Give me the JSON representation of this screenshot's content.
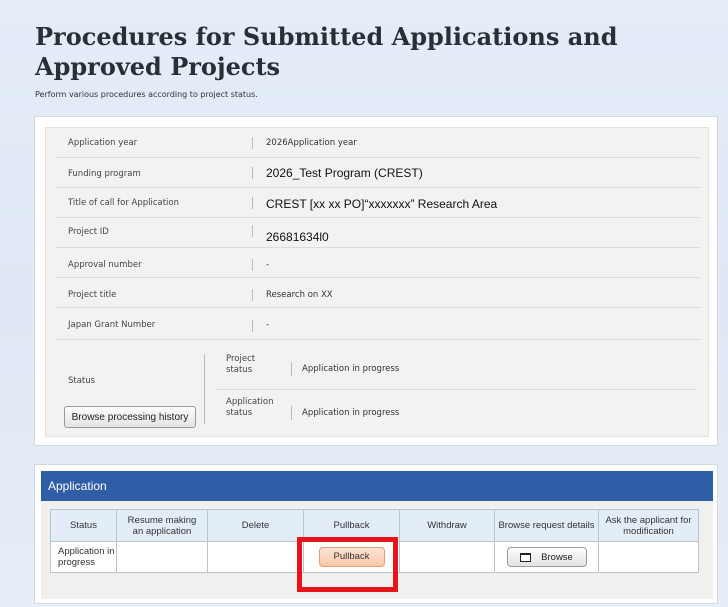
{
  "page": {
    "title": "Procedures for Submitted Applications and Approved Projects",
    "subtitle": "Perform various procedures according to project status."
  },
  "info": {
    "rows": [
      {
        "label": "Application year",
        "value": "2026Application year"
      },
      {
        "label": "Funding program",
        "value": "2026_Test Program (CREST)"
      },
      {
        "label": "Title of call for Application",
        "value": "CREST [xx xx PO]“xxxxxxx” Research Area"
      },
      {
        "label": "Project ID",
        "value": "26681634l0"
      },
      {
        "label": "Approval number",
        "value": "-"
      },
      {
        "label": "Project title",
        "value": "Research on XX"
      },
      {
        "label": "Japan Grant Number",
        "value": "-"
      }
    ],
    "status": {
      "label": "Status",
      "history_button": "Browse processing history",
      "project_status_label": "Project status",
      "project_status_value": "Application in progress",
      "application_status_label": "Application status",
      "application_status_value": "Application in progress"
    }
  },
  "application": {
    "header": "Application",
    "columns": [
      "Status",
      "Resume making an application",
      "Delete",
      "Pullback",
      "Withdraw",
      "Browse request details",
      "Ask the applicant for modification"
    ],
    "row": {
      "status": "Application in progress",
      "pullback_button": "Pullback",
      "browse_button": "Browse"
    }
  },
  "colors": {
    "header_bar": "#2f5ea6",
    "pullback_button": "#f9c8aa",
    "highlight": "#e8131b"
  }
}
